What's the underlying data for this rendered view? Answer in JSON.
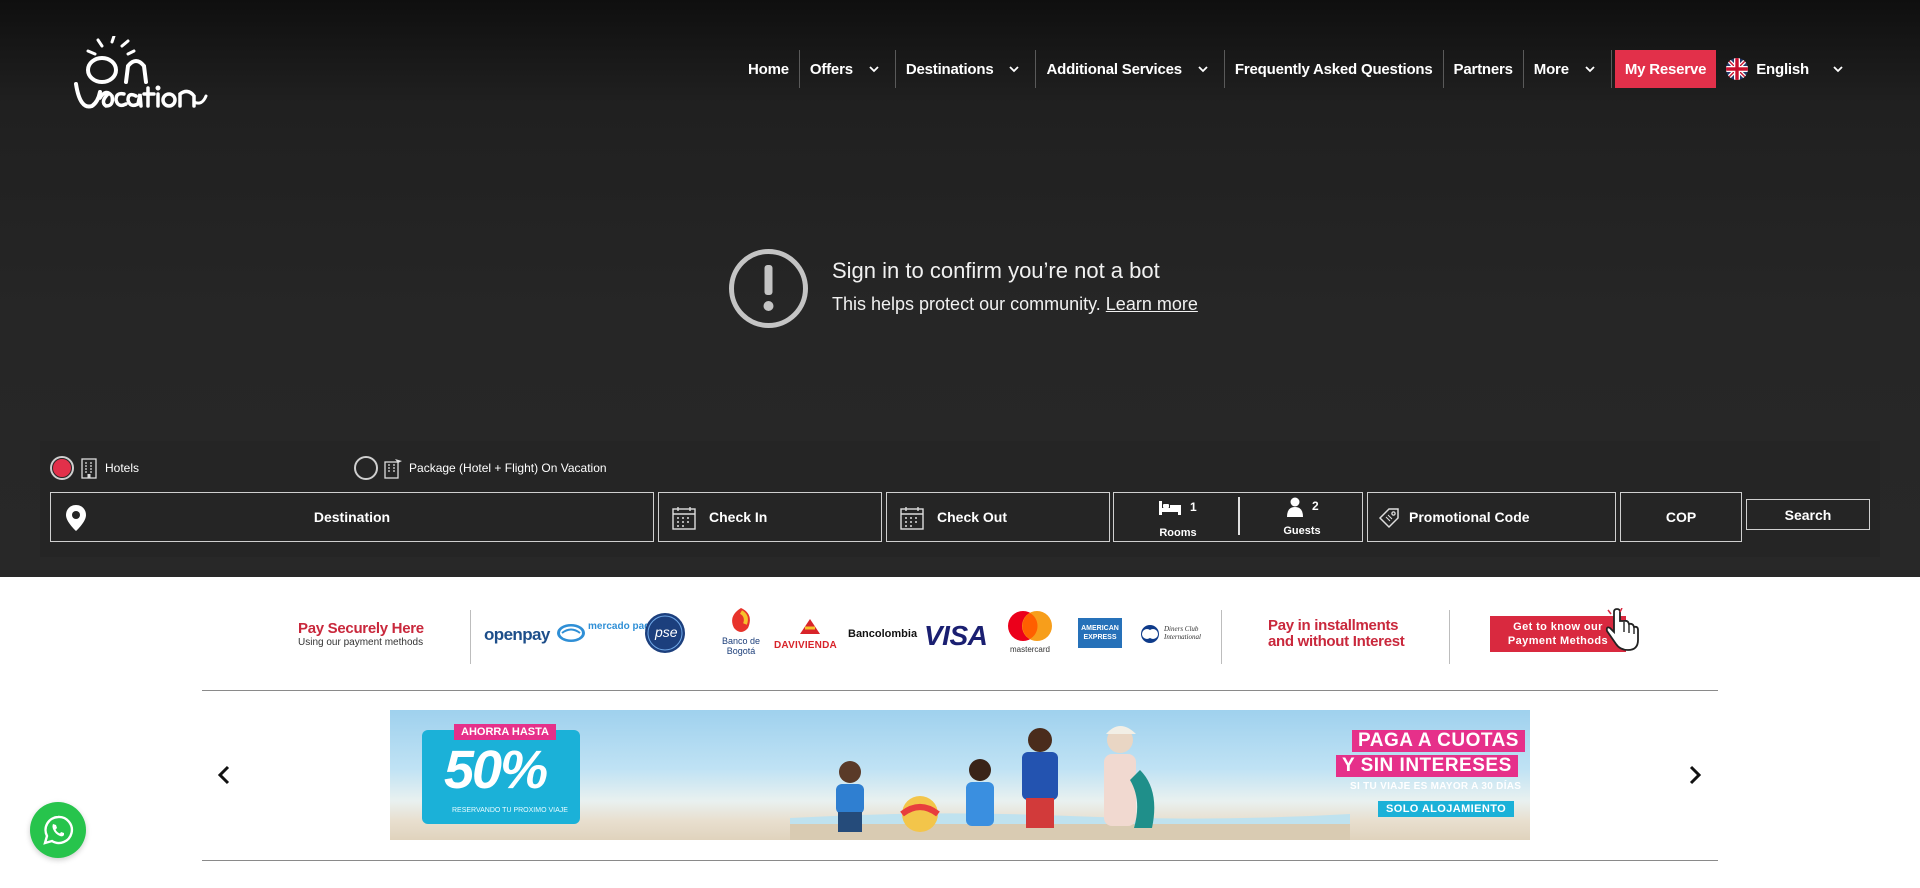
{
  "logo": {
    "text": "On Vacation"
  },
  "nav": {
    "items": [
      {
        "label": "Home",
        "chevron": false
      },
      {
        "label": "Offers",
        "chevron": true
      },
      {
        "label": "Destinations",
        "chevron": true
      },
      {
        "label": "Additional Services",
        "chevron": true
      },
      {
        "label": "Frequently Asked Questions",
        "chevron": false
      },
      {
        "label": "Partners",
        "chevron": false
      },
      {
        "label": "More",
        "chevron": true
      }
    ],
    "reserve_label": "My Reserve",
    "language_label": "English"
  },
  "bot_notice": {
    "title": "Sign in to confirm you’re not a bot",
    "subtitle": "This helps protect our community.",
    "link": "Learn more"
  },
  "booking": {
    "options": [
      {
        "label": "Hotels",
        "selected": true
      },
      {
        "label": "Package (Hotel + Flight) On Vacation",
        "selected": false
      }
    ],
    "destination_label": "Destination",
    "checkin_label": "Check In",
    "checkout_label": "Check Out",
    "rooms_count": "1",
    "rooms_label": "Rooms",
    "guests_count": "2",
    "guests_label": "Guests",
    "promo_label": "Promotional Code",
    "currency": "COP",
    "search_label": "Search"
  },
  "payments": {
    "left_title": "Pay Securely Here",
    "left_sub": "Using our payment methods",
    "logos": [
      "openpay",
      "mercado pago",
      "pse",
      "Banco de Bogotá",
      "DAVIVIENDA",
      "Bancolombia",
      "VISA",
      "mastercard",
      "AMERICAN EXPRESS",
      "Diners Club International"
    ],
    "right_line1": "Pay in installments",
    "right_line2": "and without Interest",
    "button_line1": "Get to know our",
    "button_line2": "Payment Methods"
  },
  "banner": {
    "tag": "AHORRA HASTA",
    "percent": "50%",
    "small": "RESERVANDO TU PROXIMO VIAJE",
    "right_line1": "PAGA A CUOTAS",
    "right_line2": "Y SIN INTERESES",
    "right_line3": "SI TU VIAJE ES MAYOR A 30 DÍAS",
    "right_badge": "SOLO ALOJAMIENTO"
  },
  "colors": {
    "accent_red": "#e2304a",
    "brand_red_text": "#c9283c",
    "banner_cyan": "#1bb1d8",
    "banner_pink": "#e6308a",
    "whatsapp_green": "#27c44c"
  }
}
